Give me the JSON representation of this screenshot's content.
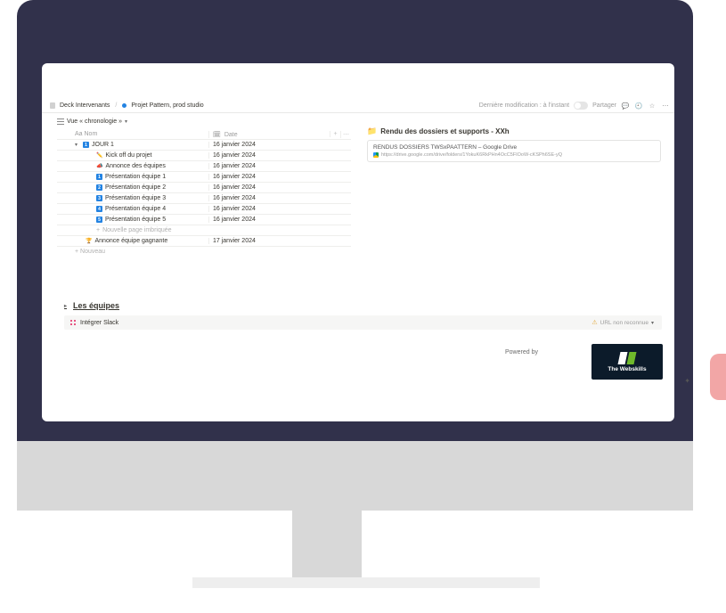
{
  "breadcrumb": {
    "item1": "Deck Intervenants",
    "item2": "Projet Pattern, prod studio"
  },
  "topbar": {
    "last_edit": "Dernière modification : à l'instant",
    "share": "Partager"
  },
  "view": {
    "label": "Vue « chronologie »"
  },
  "columns": {
    "name": "Aa Nom",
    "date": "Date",
    "date_icon": "📅"
  },
  "rows": [
    {
      "name": "JOUR 1",
      "date": "16 janvier 2024",
      "type": "group",
      "icon": "1",
      "expanded": true
    },
    {
      "name": "Kick off du projet",
      "date": "16 janvier 2024",
      "type": "sub",
      "icon": "✏️"
    },
    {
      "name": "Annonce des équipes",
      "date": "16 janvier 2024",
      "type": "sub",
      "icon": "📣"
    },
    {
      "name": "Présentation équipe 1",
      "date": "16 janvier 2024",
      "type": "sub",
      "icon": "1"
    },
    {
      "name": "Présentation équipe 2",
      "date": "16 janvier 2024",
      "type": "sub",
      "icon": "2"
    },
    {
      "name": "Présentation équipe 3",
      "date": "16 janvier 2024",
      "type": "sub",
      "icon": "3"
    },
    {
      "name": "Présentation équipe 4",
      "date": "16 janvier 2024",
      "type": "sub",
      "icon": "4"
    },
    {
      "name": "Présentation équipe 5",
      "date": "16 janvier 2024",
      "type": "sub",
      "icon": "5"
    },
    {
      "name": "Nouvelle page imbriquée",
      "date": "",
      "type": "newsub",
      "icon": "+"
    },
    {
      "name": "Annonce équipe gagnante",
      "date": "17 janvier 2024",
      "type": "item",
      "icon": "🏆"
    }
  ],
  "newrow": "+ Nouveau",
  "right": {
    "title": "Rendu des dossiers et supports - XXh",
    "drive_title": "RENDUS DOSSIERS TWSxPAATTERN – Google Drive",
    "drive_url": "https://drive.google.com/drive/folders/1YokuK6RkPHn4OcC5FIOoW-cKSPh6SE-yQ"
  },
  "section": {
    "title": "Les équipes",
    "slack": "Intégrer Slack",
    "warn": "URL non reconnue"
  },
  "powered": "Powered by",
  "logo_text": "The Webskills"
}
